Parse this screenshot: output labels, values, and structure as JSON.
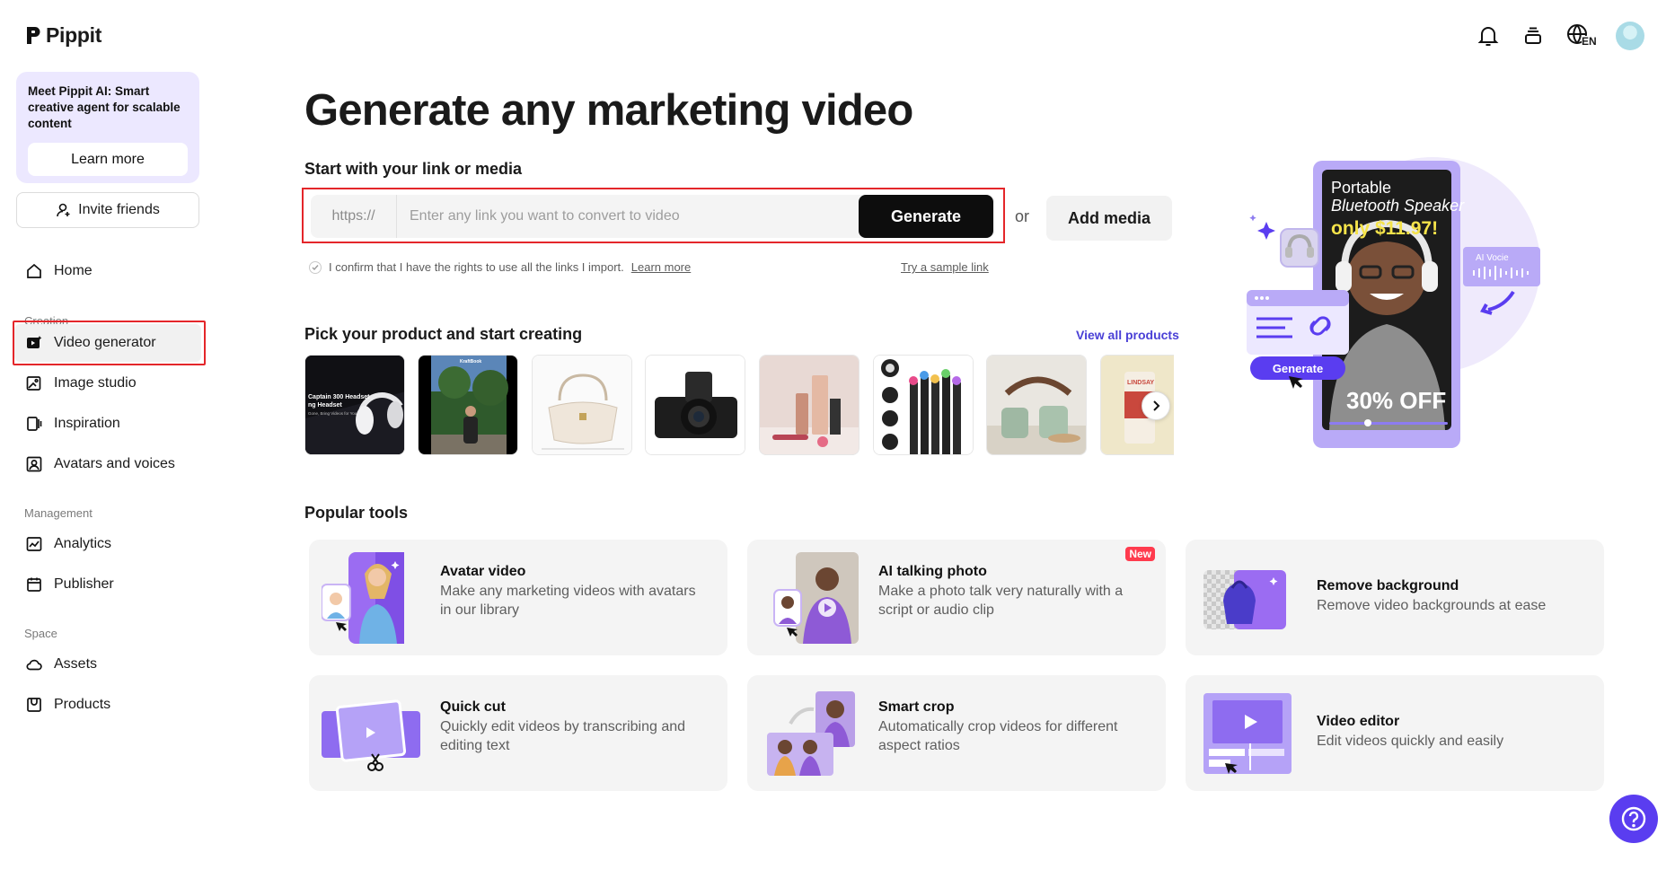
{
  "app": {
    "name": "Pippit"
  },
  "sidebar": {
    "promo": {
      "text": "Meet Pippit AI: Smart creative agent for scalable content",
      "button": "Learn more"
    },
    "invite": "Invite friends",
    "home": "Home",
    "sections": {
      "creation": "Creation",
      "management": "Management",
      "space": "Space"
    },
    "items": {
      "video_generator": "Video generator",
      "image_studio": "Image studio",
      "inspiration": "Inspiration",
      "avatars_voices": "Avatars and voices",
      "analytics": "Analytics",
      "publisher": "Publisher",
      "assets": "Assets",
      "products": "Products"
    }
  },
  "header": {
    "language": "EN"
  },
  "main": {
    "title": "Generate any marketing video",
    "start_label": "Start with your link or media",
    "input": {
      "prefix": "https://",
      "placeholder": "Enter any link you want to convert to video",
      "value": ""
    },
    "generate_button": "Generate",
    "or": "or",
    "add_media": "Add media",
    "confirm_text": "I confirm that I have the rights to use all the links I import.",
    "confirm_link": "Learn more",
    "sample_link": "Try a sample link",
    "pick_title": "Pick your product and start creating",
    "view_all": "View all products",
    "product_labels": {
      "headset": "Captain 300 Headset",
      "headset_sub": "ng Headset",
      "tagline": "Gone, Bring Videos for You",
      "brand": "KraftBook",
      "can": "LINDSAY"
    }
  },
  "tools": {
    "title": "Popular tools",
    "items": [
      {
        "name": "Avatar video",
        "desc": "Make any marketing videos with avatars in our library"
      },
      {
        "name": "AI talking photo",
        "desc": "Make a photo talk very naturally with a script or audio clip",
        "badge": "New"
      },
      {
        "name": "Remove background",
        "desc": "Remove video backgrounds at ease"
      },
      {
        "name": "Quick cut",
        "desc": "Quickly edit videos by transcribing and editing text"
      },
      {
        "name": "Smart crop",
        "desc": "Automatically crop videos for different aspect ratios"
      },
      {
        "name": "Video editor",
        "desc": "Edit videos quickly and easily"
      }
    ]
  },
  "hero": {
    "line1": "Portable",
    "line2": "Bluetooth Speaker",
    "price": "only $11.97!",
    "discount": "30% OFF",
    "ai_voice": "AI Vocie",
    "generate": "Generate"
  },
  "colors": {
    "accent": "#5a3df0",
    "highlight_red": "#e4262a",
    "link": "#4a40d6",
    "hero_purple": "#b9aaf7"
  }
}
